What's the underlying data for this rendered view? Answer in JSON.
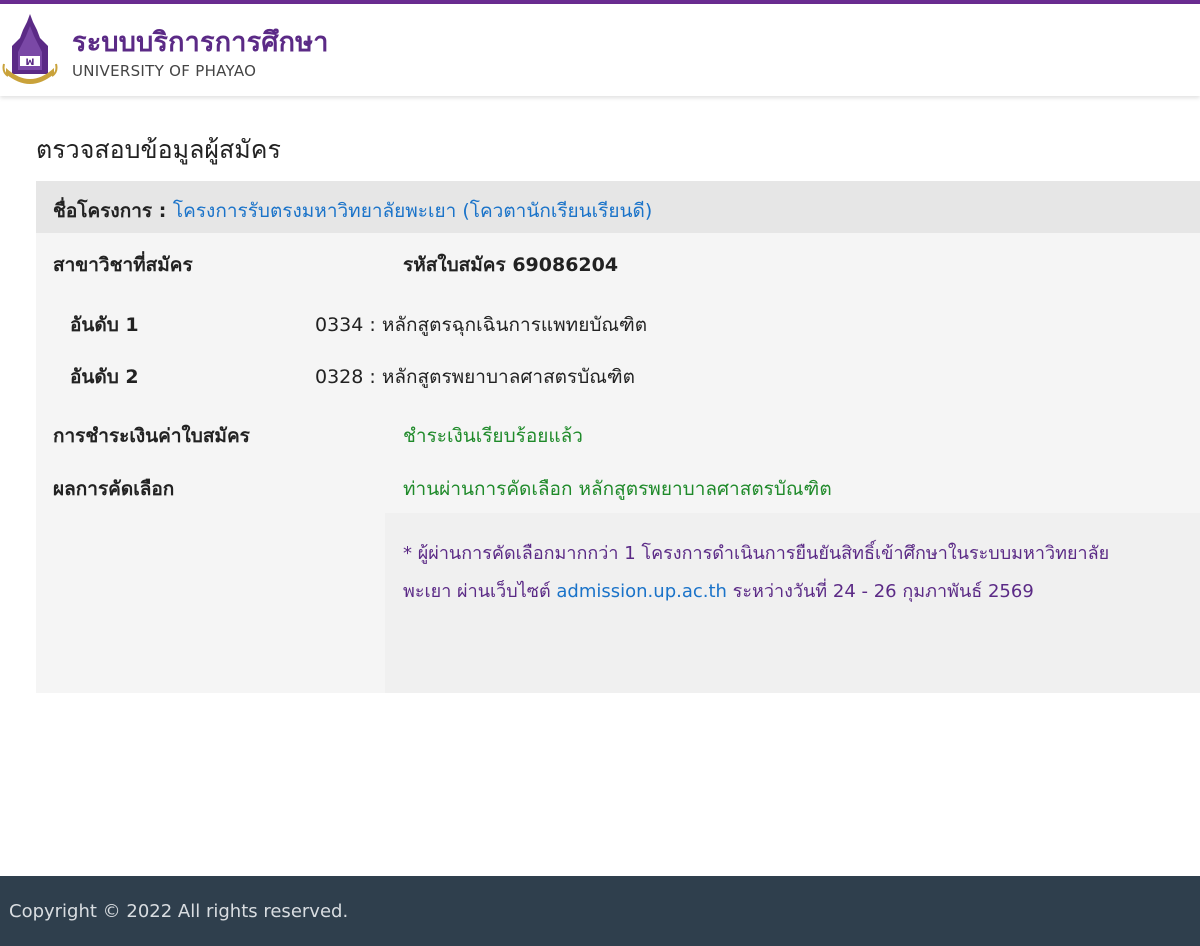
{
  "brand": {
    "title": "ระบบบริการการศึกษา",
    "subtitle": "UNIVERSITY OF PHAYAO",
    "accent_color": "#5b2a86"
  },
  "page": {
    "title": "ตรวจสอบข้อมูลผู้สมัคร"
  },
  "project": {
    "label": "ชื่อโครงการ :",
    "name": "โครงการรับตรงมหาวิทยาลัยพะเยา (โควตานักเรียนเรียนดี)"
  },
  "application": {
    "major_label": "สาขาวิชาที่สมัคร",
    "code_text": "รหัสใบสมัคร 69086204",
    "choices": [
      {
        "rank_label": "อันดับ 1",
        "program": "0334 : หลักสูตรฉุกเฉินการแพทยบัณฑิต"
      },
      {
        "rank_label": "อันดับ 2",
        "program": "0328 : หลักสูตรพยาบาลศาสตรบัณฑิต"
      }
    ],
    "payment_label": "การชำระเงินค่าใบสมัคร",
    "payment_status": "ชำระเงินเรียบร้อยแล้ว",
    "result_label": "ผลการคัดเลือก",
    "result_text": "ท่านผ่านการคัดเลือก หลักสูตรพยาบาลศาสตรบัณฑิต",
    "status_color": "#1f8a2a"
  },
  "notice": {
    "text_before": "* ผู้ผ่านการคัดเลือกมากกว่า 1 โครงการดำเนินการยืนยันสิทธิ์เข้าศึกษาในระบบมหาวิทยาลัยพะเยา ผ่านเว็บไซต์ ",
    "link_text": "admission.up.ac.th",
    "text_after": " ระหว่างวันที่ 24 - 26 กุมภาพันธ์ 2569"
  },
  "footer": {
    "copyright": "Copyright © 2022 All rights reserved."
  }
}
